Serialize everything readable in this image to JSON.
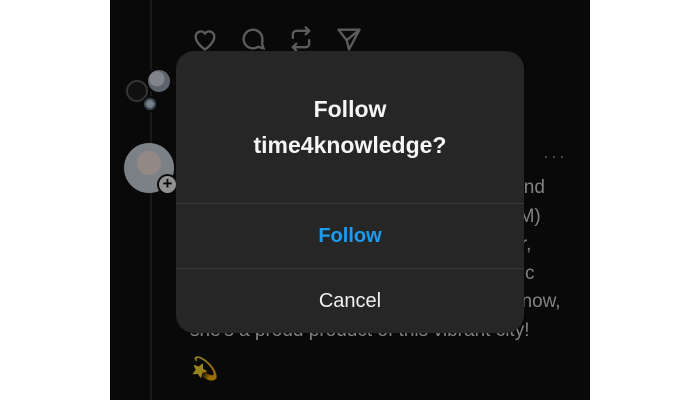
{
  "dialog": {
    "title_line1": "Follow",
    "title_line2": "time4knowledge?",
    "follow_label": "Follow",
    "cancel_label": "Cancel"
  },
  "post": {
    "lines": [
      "hind",
      "MOM)",
      "tor,",
      "c",
      "know,",
      "she's a proud product of this vibrant city!"
    ],
    "more_label": "···",
    "emoji": "💫"
  },
  "icons": {
    "like": "heart-icon",
    "comment": "comment-icon",
    "repost": "repost-icon",
    "share": "send-icon",
    "follow_plus": "plus-icon"
  },
  "colors": {
    "background": "#101010",
    "dialog": "#262626",
    "accent": "#1d9bf0"
  }
}
